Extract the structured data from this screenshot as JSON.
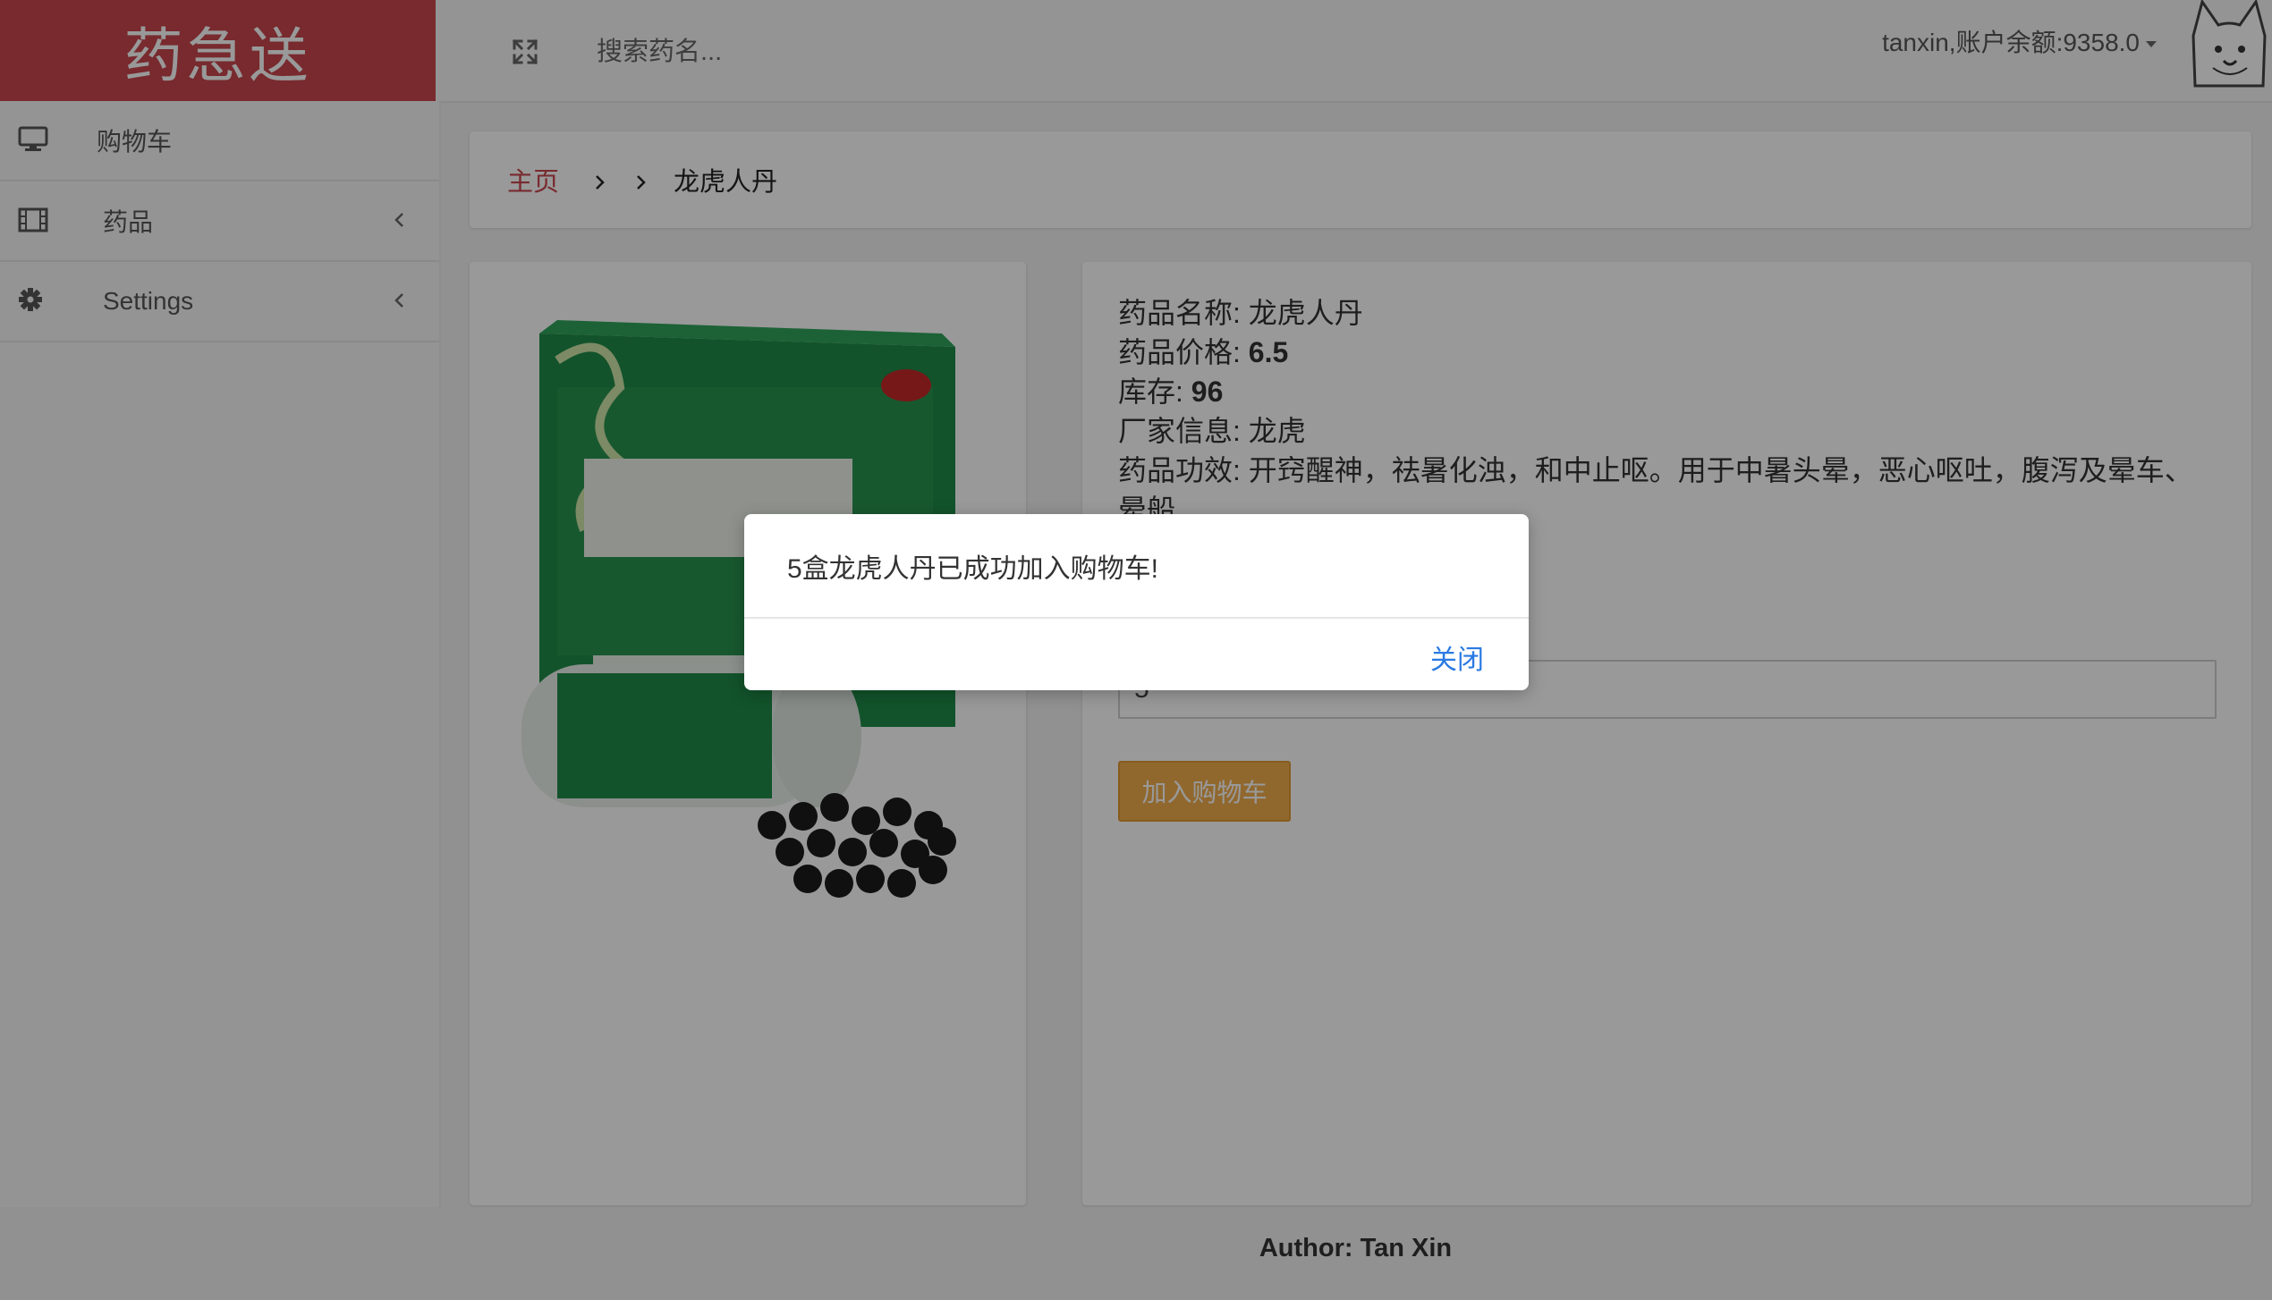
{
  "brand": {
    "title": "药急送",
    "color": "#c9464e"
  },
  "topbar": {
    "search_placeholder": "搜索药名...",
    "user_menu_label": "tanxin,账户余额:9358.0"
  },
  "sidebar": {
    "items": [
      {
        "label": "购物车",
        "icon": "monitor-icon",
        "has_chevron": false
      },
      {
        "label": "药品",
        "icon": "film-icon",
        "has_chevron": true
      },
      {
        "label": "Settings",
        "icon": "gear-icon",
        "has_chevron": true
      }
    ]
  },
  "breadcrumb": {
    "home": "主页",
    "middle": "",
    "current": "龙虎人丹"
  },
  "product": {
    "name_label": "药品名称: ",
    "name": "龙虎人丹",
    "price_label": "药品价格: ",
    "price": "6.5",
    "stock_label": "库存: ",
    "stock": "96",
    "maker_label": "厂家信息: ",
    "maker": "龙虎",
    "effect_label": "药品功效: ",
    "effect": "开窍醒神，祛暑化浊，和中止呕。用于中暑头晕，恶心呕吐，腹泻及晕车、晕船",
    "quantity_value": "5",
    "add_button": "加入购物车",
    "accent_color": "#f0ad4e"
  },
  "footer": {
    "text": "Author: Tan Xin"
  },
  "modal": {
    "message": "5盒龙虎人丹已成功加入购物车!",
    "close_label": "关闭",
    "link_color": "#2a7ae2"
  }
}
